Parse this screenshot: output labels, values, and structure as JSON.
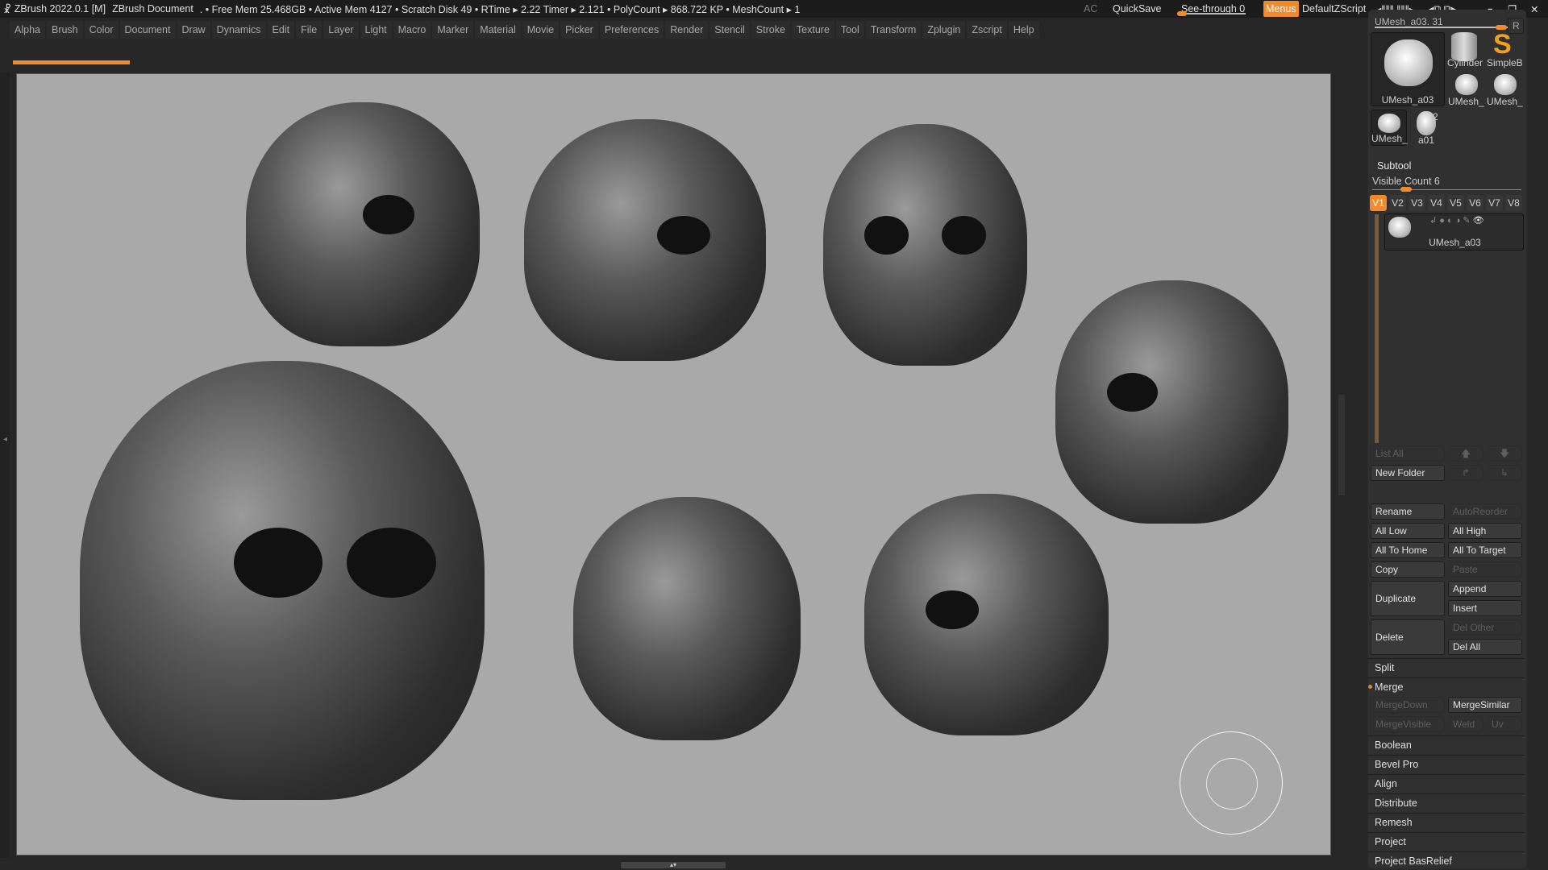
{
  "titlebar": {
    "app": "ZBrush 2022.0.1 [M]",
    "document": "ZBrush Document",
    "stats": ". • Free Mem 25.468GB • Active Mem 4127 • Scratch Disk 49 •  RTime ▸ 2.22 Timer ▸ 2.121 • PolyCount ▸ 868.722 KP  • MeshCount ▸ 1",
    "ac": "AC",
    "quicksave": "QuickSave",
    "seethrough": "See-through  0",
    "seethrough_value": 0,
    "menus": "Menus",
    "script": "DefaultZScript"
  },
  "menus": [
    "Alpha",
    "Brush",
    "Color",
    "Document",
    "Draw",
    "Dynamics",
    "Edit",
    "File",
    "Layer",
    "Light",
    "Macro",
    "Marker",
    "Material",
    "Movie",
    "Picker",
    "Preferences",
    "Render",
    "Stencil",
    "Stroke",
    "Texture",
    "Tool",
    "Transform",
    "Zplugin",
    "Zscript",
    "Help"
  ],
  "colors": {
    "accent": "#f08a2c",
    "canvas": "#a9a9a9"
  },
  "tool": {
    "slider_label": "UMesh_a03. 31",
    "r_label": "R",
    "current": "UMesh_a03",
    "thumbs": [
      "Cylinder",
      "SimpleB",
      "UMesh_",
      "UMesh_",
      "UMesh_",
      "a01"
    ],
    "badge": "2"
  },
  "subtool": {
    "title": "Subtool",
    "visible_count": "Visible Count 6",
    "versions": [
      "V1",
      "V2",
      "V3",
      "V4",
      "V5",
      "V6",
      "V7",
      "V8"
    ],
    "active_version": "V1",
    "item": "UMesh_a03",
    "buttons": {
      "list_all": "List All",
      "new_folder": "New Folder",
      "rename": "Rename",
      "autoreorder": "AutoReorder",
      "all_low": "All Low",
      "all_high": "All High",
      "all_to_home": "All To Home",
      "all_to_target": "All To Target",
      "copy": "Copy",
      "paste": "Paste",
      "duplicate": "Duplicate",
      "append": "Append",
      "insert": "Insert",
      "delete": "Delete",
      "del_other": "Del Other",
      "del_all": "Del All",
      "mergedown": "MergeDown",
      "mergesimilar": "MergeSimilar",
      "mergevisible": "MergeVisible",
      "weld": "Weld",
      "uv": "Uv"
    },
    "sections": [
      "Split",
      "Merge",
      "Boolean",
      "Bevel Pro",
      "Align",
      "Distribute",
      "Remesh",
      "Project",
      "Project BasRelief"
    ]
  }
}
